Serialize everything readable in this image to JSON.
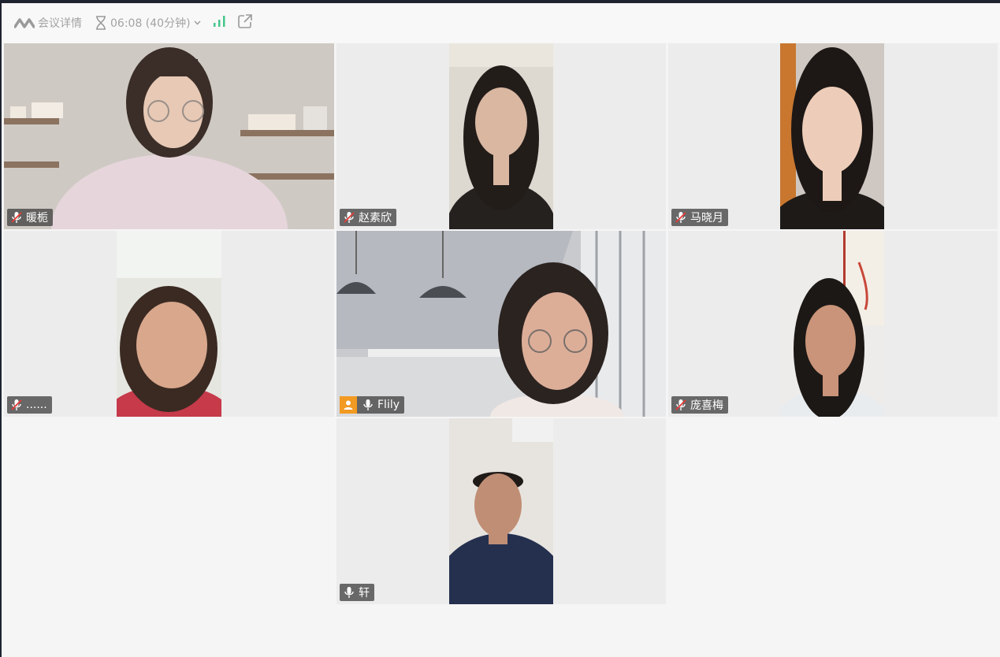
{
  "toolbar": {
    "meeting_details": "会议详情",
    "timer": "06:08 (40分钟)",
    "icons": [
      "tencent-meeting-logo-icon",
      "hourglass-icon",
      "chevron-down-icon",
      "signal-icon",
      "share-out-icon"
    ]
  },
  "colors": {
    "active_speaker_border": "#2fc36e",
    "host_badge": "#f29a22",
    "signal": "#45c68a"
  },
  "participants": [
    {
      "name": "暖栀",
      "mic": "muted"
    },
    {
      "name": "赵素欣",
      "mic": "muted"
    },
    {
      "name": "马晓月",
      "mic": "muted"
    },
    {
      "name": "......",
      "mic": "muted"
    },
    {
      "name": "Flily",
      "mic": "on",
      "host": true,
      "active": true
    },
    {
      "name": "庞喜梅",
      "mic": "muted"
    },
    {
      "name": "轩",
      "mic": "on"
    }
  ]
}
